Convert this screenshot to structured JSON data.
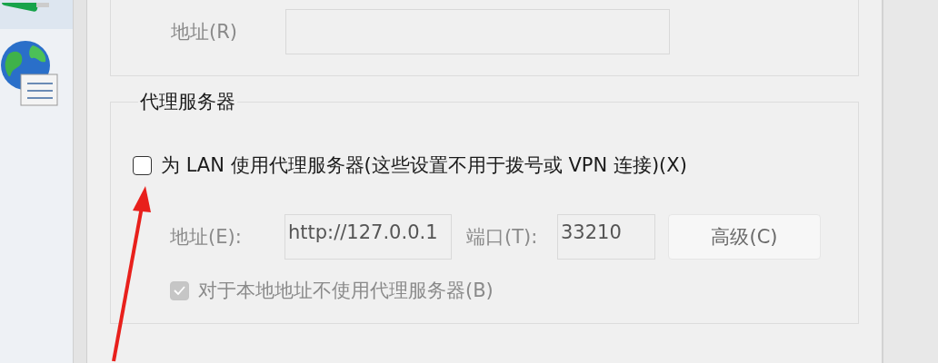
{
  "top_group": {
    "address": {
      "label": "地址(R)",
      "disabled": true
    }
  },
  "proxy_group": {
    "legend": "代理服务器",
    "use_proxy": {
      "label": "为 LAN 使用代理服务器(这些设置不用于拨号或 VPN 连接)(X)",
      "checked": false
    },
    "address": {
      "label": "地址(E):",
      "value": "http://127.0.0.1",
      "disabled": true
    },
    "port": {
      "label": "端口(T):",
      "value": "33210",
      "disabled": true
    },
    "advanced_button": {
      "label": "高级(C)",
      "disabled": true
    },
    "bypass_local": {
      "label": "对于本地地址不使用代理服务器(B)",
      "checked": true,
      "disabled": true
    }
  }
}
